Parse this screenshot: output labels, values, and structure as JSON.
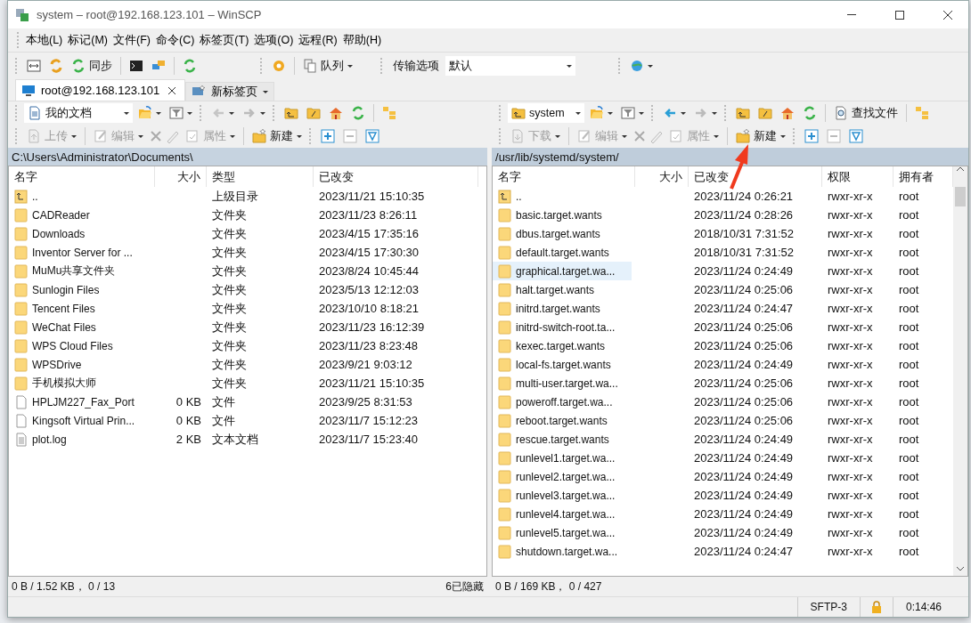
{
  "window": {
    "title": "system – root@192.168.123.101 – WinSCP"
  },
  "menu": [
    "本地(L)",
    "标记(M)",
    "文件(F)",
    "命令(C)",
    "标签页(T)",
    "选项(O)",
    "远程(R)",
    "帮助(H)"
  ],
  "toolbar": {
    "sync": "同步",
    "queue": "队列",
    "transfer_label": "传输选项",
    "transfer_value": "默认"
  },
  "tabs": [
    {
      "label": "root@192.168.123.101",
      "selected": true
    },
    {
      "label": "新标签页",
      "selected": false
    }
  ],
  "panels": [
    {
      "location": "我的文档",
      "back_enabled": false,
      "actions": [
        {
          "label": "上传",
          "disabled": true
        },
        {
          "label": "编辑",
          "disabled": true
        },
        {
          "label": "属性",
          "disabled": true
        },
        {
          "label": "新建",
          "disabled": false
        }
      ],
      "path": "C:\\Users\\Administrator\\Documents\\",
      "columns": [
        "名字",
        "大小",
        "类型",
        "已改变"
      ],
      "rows": [
        {
          "kind": "parent",
          "selected": false,
          "cells": [
            "..",
            "",
            "上级目录",
            "2023/11/21 15:10:35"
          ]
        },
        {
          "kind": "folder",
          "selected": false,
          "cells": [
            "CADReader",
            "",
            "文件夹",
            "2023/11/23 8:26:11"
          ]
        },
        {
          "kind": "folder",
          "selected": false,
          "cells": [
            "Downloads",
            "",
            "文件夹",
            "2023/4/15 17:35:16"
          ]
        },
        {
          "kind": "folder",
          "selected": false,
          "cells": [
            "Inventor Server for ...",
            "",
            "文件夹",
            "2023/4/15 17:30:30"
          ]
        },
        {
          "kind": "folder",
          "selected": false,
          "cells": [
            "MuMu共享文件夹",
            "",
            "文件夹",
            "2023/8/24 10:45:44"
          ]
        },
        {
          "kind": "folder",
          "selected": false,
          "cells": [
            "Sunlogin Files",
            "",
            "文件夹",
            "2023/5/13 12:12:03"
          ]
        },
        {
          "kind": "folder",
          "selected": false,
          "cells": [
            "Tencent Files",
            "",
            "文件夹",
            "2023/10/10 8:18:21"
          ]
        },
        {
          "kind": "folder",
          "selected": false,
          "cells": [
            "WeChat Files",
            "",
            "文件夹",
            "2023/11/23 16:12:39"
          ]
        },
        {
          "kind": "folder",
          "selected": false,
          "cells": [
            "WPS Cloud Files",
            "",
            "文件夹",
            "2023/11/23 8:23:48"
          ]
        },
        {
          "kind": "folder",
          "selected": false,
          "cells": [
            "WPSDrive",
            "",
            "文件夹",
            "2023/9/21 9:03:12"
          ]
        },
        {
          "kind": "folder",
          "selected": false,
          "cells": [
            "手机模拟大师",
            "",
            "文件夹",
            "2023/11/21 15:10:35"
          ]
        },
        {
          "kind": "file",
          "selected": false,
          "cells": [
            "HPLJM227_Fax_Port",
            "0 KB",
            "文件",
            "2023/9/25 8:31:53"
          ]
        },
        {
          "kind": "file",
          "selected": false,
          "cells": [
            "Kingsoft Virtual Prin...",
            "0 KB",
            "文件",
            "2023/11/7 15:12:23"
          ]
        },
        {
          "kind": "text",
          "selected": false,
          "cells": [
            "plot.log",
            "2 KB",
            "文本文档",
            "2023/11/7 15:23:40"
          ]
        }
      ],
      "status": "0 B / 1.52 KB， 0 / 13",
      "hidden": "6已隐藏"
    },
    {
      "location": "system",
      "back_enabled": true,
      "find": "查找文件",
      "actions": [
        {
          "label": "下载",
          "disabled": true
        },
        {
          "label": "编辑",
          "disabled": true
        },
        {
          "label": "属性",
          "disabled": true
        },
        {
          "label": "新建",
          "disabled": false
        }
      ],
      "path": "/usr/lib/systemd/system/",
      "columns": [
        "名字",
        "大小",
        "已改变",
        "权限",
        "拥有者"
      ],
      "rows": [
        {
          "kind": "parent",
          "selected": false,
          "cells": [
            "..",
            "",
            "2023/11/24 0:26:21",
            "rwxr-xr-x",
            "root"
          ]
        },
        {
          "kind": "folder",
          "selected": false,
          "cells": [
            "basic.target.wants",
            "",
            "2023/11/24 0:28:26",
            "rwxr-xr-x",
            "root"
          ]
        },
        {
          "kind": "folder",
          "selected": false,
          "cells": [
            "dbus.target.wants",
            "",
            "2018/10/31 7:31:52",
            "rwxr-xr-x",
            "root"
          ]
        },
        {
          "kind": "folder",
          "selected": false,
          "cells": [
            "default.target.wants",
            "",
            "2018/10/31 7:31:52",
            "rwxr-xr-x",
            "root"
          ]
        },
        {
          "kind": "folder",
          "selected": true,
          "cells": [
            "graphical.target.wa...",
            "",
            "2023/11/24 0:24:49",
            "rwxr-xr-x",
            "root"
          ]
        },
        {
          "kind": "folder",
          "selected": false,
          "cells": [
            "halt.target.wants",
            "",
            "2023/11/24 0:25:06",
            "rwxr-xr-x",
            "root"
          ]
        },
        {
          "kind": "folder",
          "selected": false,
          "cells": [
            "initrd.target.wants",
            "",
            "2023/11/24 0:24:47",
            "rwxr-xr-x",
            "root"
          ]
        },
        {
          "kind": "folder",
          "selected": false,
          "cells": [
            "initrd-switch-root.ta...",
            "",
            "2023/11/24 0:25:06",
            "rwxr-xr-x",
            "root"
          ]
        },
        {
          "kind": "folder",
          "selected": false,
          "cells": [
            "kexec.target.wants",
            "",
            "2023/11/24 0:25:06",
            "rwxr-xr-x",
            "root"
          ]
        },
        {
          "kind": "folder",
          "selected": false,
          "cells": [
            "local-fs.target.wants",
            "",
            "2023/11/24 0:24:49",
            "rwxr-xr-x",
            "root"
          ]
        },
        {
          "kind": "folder",
          "selected": false,
          "cells": [
            "multi-user.target.wa...",
            "",
            "2023/11/24 0:25:06",
            "rwxr-xr-x",
            "root"
          ]
        },
        {
          "kind": "folder",
          "selected": false,
          "cells": [
            "poweroff.target.wa...",
            "",
            "2023/11/24 0:25:06",
            "rwxr-xr-x",
            "root"
          ]
        },
        {
          "kind": "folder",
          "selected": false,
          "cells": [
            "reboot.target.wants",
            "",
            "2023/11/24 0:25:06",
            "rwxr-xr-x",
            "root"
          ]
        },
        {
          "kind": "folder",
          "selected": false,
          "cells": [
            "rescue.target.wants",
            "",
            "2023/11/24 0:24:49",
            "rwxr-xr-x",
            "root"
          ]
        },
        {
          "kind": "folder",
          "selected": false,
          "cells": [
            "runlevel1.target.wa...",
            "",
            "2023/11/24 0:24:49",
            "rwxr-xr-x",
            "root"
          ]
        },
        {
          "kind": "folder",
          "selected": false,
          "cells": [
            "runlevel2.target.wa...",
            "",
            "2023/11/24 0:24:49",
            "rwxr-xr-x",
            "root"
          ]
        },
        {
          "kind": "folder",
          "selected": false,
          "cells": [
            "runlevel3.target.wa...",
            "",
            "2023/11/24 0:24:49",
            "rwxr-xr-x",
            "root"
          ]
        },
        {
          "kind": "folder",
          "selected": false,
          "cells": [
            "runlevel4.target.wa...",
            "",
            "2023/11/24 0:24:49",
            "rwxr-xr-x",
            "root"
          ]
        },
        {
          "kind": "folder",
          "selected": false,
          "cells": [
            "runlevel5.target.wa...",
            "",
            "2023/11/24 0:24:49",
            "rwxr-xr-x",
            "root"
          ]
        },
        {
          "kind": "folder",
          "selected": false,
          "cells": [
            "shutdown.target.wa...",
            "",
            "2023/11/24 0:24:47",
            "rwxr-xr-x",
            "root"
          ]
        }
      ],
      "status": "0 B / 169 KB， 0 / 427"
    }
  ],
  "status_bar": [
    "SFTP-3",
    "0:14:46"
  ]
}
